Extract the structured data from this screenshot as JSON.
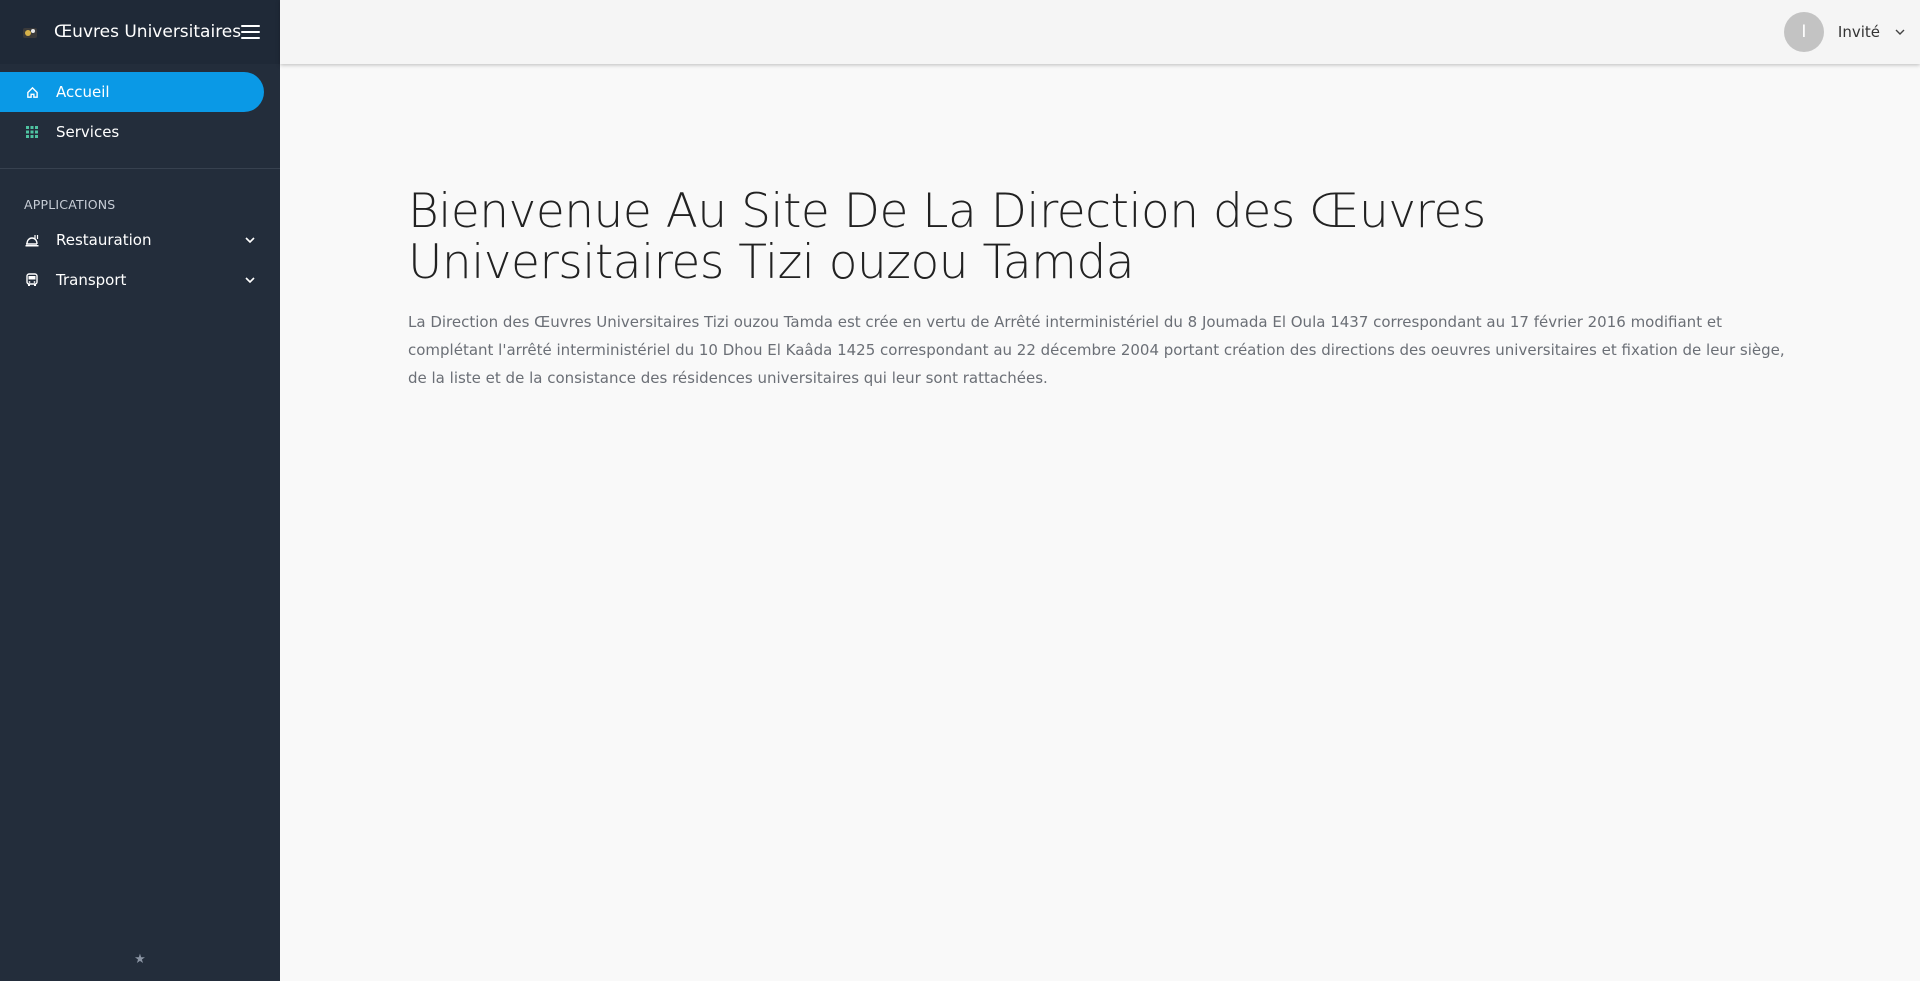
{
  "brand": {
    "name": "Œuvres Universitaires"
  },
  "nav": {
    "items": [
      {
        "label": "Accueil",
        "icon": "home-icon",
        "active": true
      },
      {
        "label": "Services",
        "icon": "grid-icon",
        "active": false
      }
    ],
    "section_title": "APPLICATIONS",
    "apps": [
      {
        "label": "Restauration",
        "icon": "food-icon"
      },
      {
        "label": "Transport",
        "icon": "bus-icon"
      }
    ],
    "footer_icon": "star-icon"
  },
  "user": {
    "initial": "I",
    "name": "Invité"
  },
  "main": {
    "title": "Bienvenue Au Site De La Direction des Œuvres Universitaires Tizi ouzou Tamda",
    "intro": "La Direction des Œuvres Universitaires Tizi ouzou Tamda est crée en vertu de Arrêté interministériel du 8 Joumada El Oula 1437 correspondant au 17 février 2016 modifiant et complétant l'arrêté interministériel du 10 Dhou El Kaâda 1425 correspondant au 22 décembre 2004 portant création des directions des oeuvres universitaires et fixation de leur siège, de la liste et de la consistance des résidences universitaires qui leur sont rattachées."
  },
  "colors": {
    "sidebar": "#232d3b",
    "accent": "#0a99e6",
    "topbar": "#f5f5f5"
  }
}
